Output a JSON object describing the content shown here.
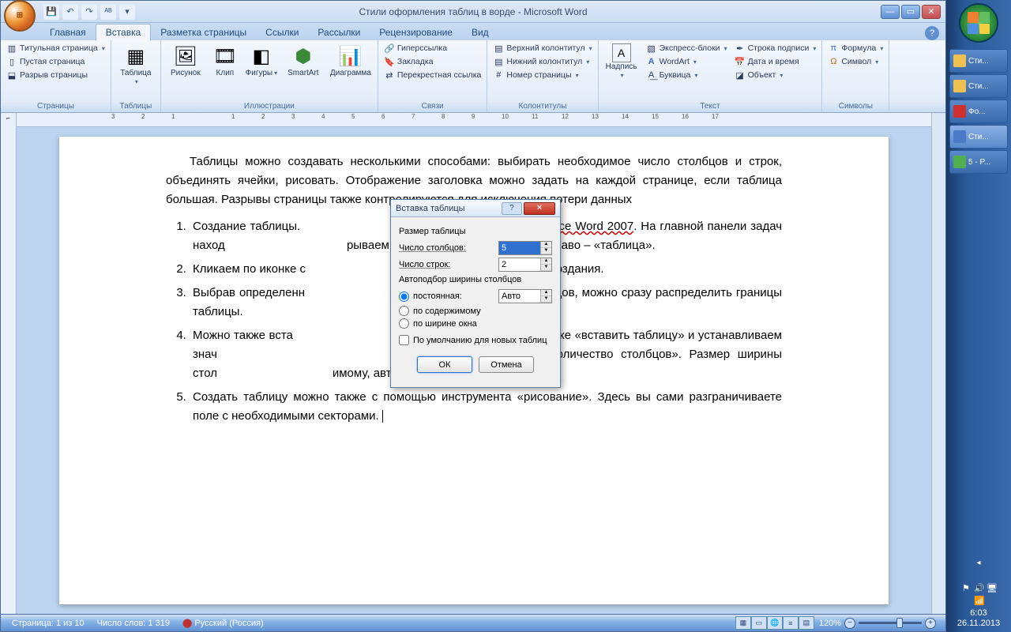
{
  "window": {
    "title": "Стили оформления таблиц в ворде - Microsoft Word",
    "qat": {
      "save": "💾",
      "undo": "↶",
      "redo": "↷",
      "spell": "ᴬᴮ"
    }
  },
  "tabs": [
    "Главная",
    "Вставка",
    "Разметка страницы",
    "Ссылки",
    "Рассылки",
    "Рецензирование",
    "Вид"
  ],
  "ribbon": {
    "pages": {
      "label": "Страницы",
      "title_page": "Титульная страница",
      "blank": "Пустая страница",
      "break": "Разрыв страницы"
    },
    "tables": {
      "label": "Таблицы",
      "table": "Таблица"
    },
    "illus": {
      "label": "Иллюстрации",
      "picture": "Рисунок",
      "clip": "Клип",
      "shapes": "Фигуры",
      "smartart": "SmartArt",
      "chart": "Диаграмма"
    },
    "links": {
      "label": "Связи",
      "hyperlink": "Гиперссылка",
      "bookmark": "Закладка",
      "crossref": "Перекрестная ссылка"
    },
    "headers": {
      "label": "Колонтитулы",
      "header": "Верхний колонтитул",
      "footer": "Нижний колонтитул",
      "pagenum": "Номер страницы"
    },
    "text": {
      "label": "Текст",
      "textbox": "Надпись",
      "quickparts": "Экспресс-блоки",
      "wordart": "WordArt",
      "dropcap": "Буквица",
      "sigline": "Строка подписи",
      "datetime": "Дата и время",
      "object": "Объект"
    },
    "symbols": {
      "label": "Символы",
      "formula": "Формула",
      "symbol": "Символ"
    }
  },
  "document": {
    "para": "Таблицы можно создавать несколькими способами: выбирать необходимое число столбцов и строк, объединять ячейки, рисовать. Отображение заголовка можно задать на каждой странице, если таблица большая. Разрывы страницы также контролируются для исключения потери данных",
    "li1a": "Создание таблицы. ",
    "li1b": "rosoft Office Word 2007",
    "li1c": ". На главной панели задач наход",
    "li1d": "рываем ее.  Второй раздел с лева направо – «таблица».",
    "li2": "Кликаем по иконке с",
    "li2b": "для ее создания.",
    "li3": "Выбрав определенн",
    "li3b": "лбцов, можно сразу распределить границы таблицы.",
    "li4": "Можно также вста",
    "li4b": "по строке «вставить таблицу» и устанавливаем знач",
    "li4c": "во строк», «количество столбцов». Размер ширины стол",
    "li4d": "имому, авто, постоянным.",
    "li5": "Создать таблицу можно также с помощью инструмента «рисование». Здесь вы сами разграничиваете поле с необходимыми секторами. "
  },
  "dialog": {
    "title": "Вставка таблицы",
    "size_label": "Размер таблицы",
    "cols_label": "Число столбцов:",
    "cols": "5",
    "rows_label": "Число строк:",
    "rows": "2",
    "autofit_label": "Автоподбор ширины столбцов",
    "fixed": "постоянная:",
    "fixed_val": "Авто",
    "content": "по содержимому",
    "window": "по ширине окна",
    "default": "По умолчанию для новых таблиц",
    "ok": "ОК",
    "cancel": "Отмена"
  },
  "statusbar": {
    "page": "Страница: 1 из 10",
    "words": "Число слов: 1 319",
    "lang": "Русский (Россия)",
    "zoom": "120%"
  },
  "taskbar": {
    "items": [
      {
        "label": "Сти...",
        "icon": "#f0c050"
      },
      {
        "label": "Сти...",
        "icon": "#f0c050"
      },
      {
        "label": "Фо...",
        "icon": "#d03030"
      },
      {
        "label": "Сти...",
        "icon": "#4a7ac8"
      },
      {
        "label": "5 - P...",
        "icon": "#50b050"
      }
    ],
    "time": "6:03",
    "date": "26.11.2013"
  }
}
